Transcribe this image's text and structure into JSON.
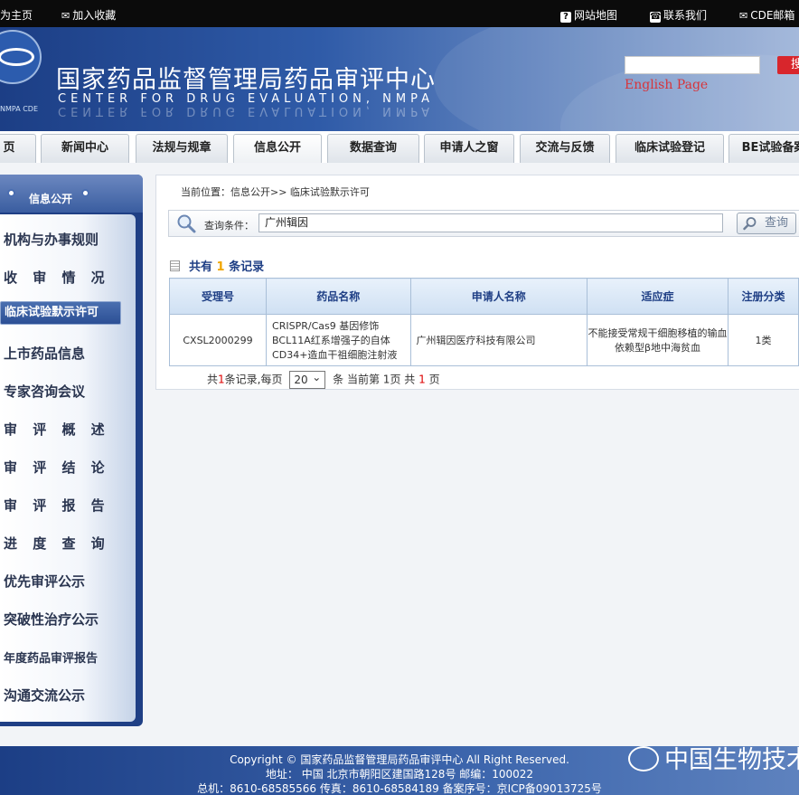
{
  "topbar": {
    "homepage": "为主页",
    "favorite": "加入收藏",
    "sitemap": "网站地图",
    "contact": "联系我们",
    "mail": "CDE邮箱"
  },
  "header": {
    "title_cn": "国家药品监督管理局药品审评中心",
    "title_en": "CENTER FOR DRUG EVALUATION, NMPA",
    "logo_text": "NMPA CDE",
    "english_link": "English Page",
    "search_button": "搜"
  },
  "nav": {
    "tabs": [
      "页",
      "新闻中心",
      "法规与规章",
      "信息公开",
      "数据查询",
      "申请人之窗",
      "交流与反馈",
      "临床试验登记",
      "BE试验备案"
    ]
  },
  "sidebar": {
    "header": "信息公开",
    "items": [
      "机构与办事规则",
      "收 审 情 况",
      "临床试验默示许可",
      "上市药品信息",
      "专家咨询会议",
      "审 评 概 述",
      "审 评 结 论",
      "审 评 报 告",
      "进 度 查 询",
      "优先审评公示",
      "突破性治疗公示",
      "年度药品审评报告",
      "沟通交流公示"
    ]
  },
  "main": {
    "breadcrumb": "当前位置：信息公开>> 临床试验默示许可",
    "query_label": "查询条件：",
    "query_value": "广州辑因",
    "query_button": "查询",
    "record_prefix": "共有",
    "record_count": "1",
    "record_suffix": "条记录"
  },
  "table": {
    "headers": [
      "受理号",
      "药品名称",
      "申请人名称",
      "适应症",
      "注册分类"
    ],
    "rows": [
      [
        "CXSL2000299",
        "CRISPR/Cas9 基因修饰BCL11A红系增强子的自体CD34+造血干祖细胞注射液",
        "广州辑因医疗科技有限公司",
        "不能接受常规干细胞移植的输血依赖型β地中海贫血",
        "1类"
      ]
    ]
  },
  "pager": {
    "total_prefix": "共",
    "total": "1",
    "total_suffix": "条记录,每页",
    "page_size": "20",
    "mid": "条 当前第",
    "current": "1",
    "pages_label": "页 共",
    "pages": "1",
    "end": "页"
  },
  "footer": {
    "line1": "Copyright © 国家药品监督管理局药品审评中心    All Right Reserved.",
    "line2": "地址：  中国  北京市朝阳区建国路128号      邮编：100022",
    "line3": "总机：8610-68585566      传真：8610-68584189    备案序号：京ICP备09013725号",
    "watermark": "中国生物技术"
  },
  "colors": {
    "header_blue": "#1c3e85",
    "search_red": "#d8262c",
    "count_orange": "#f0a500"
  }
}
